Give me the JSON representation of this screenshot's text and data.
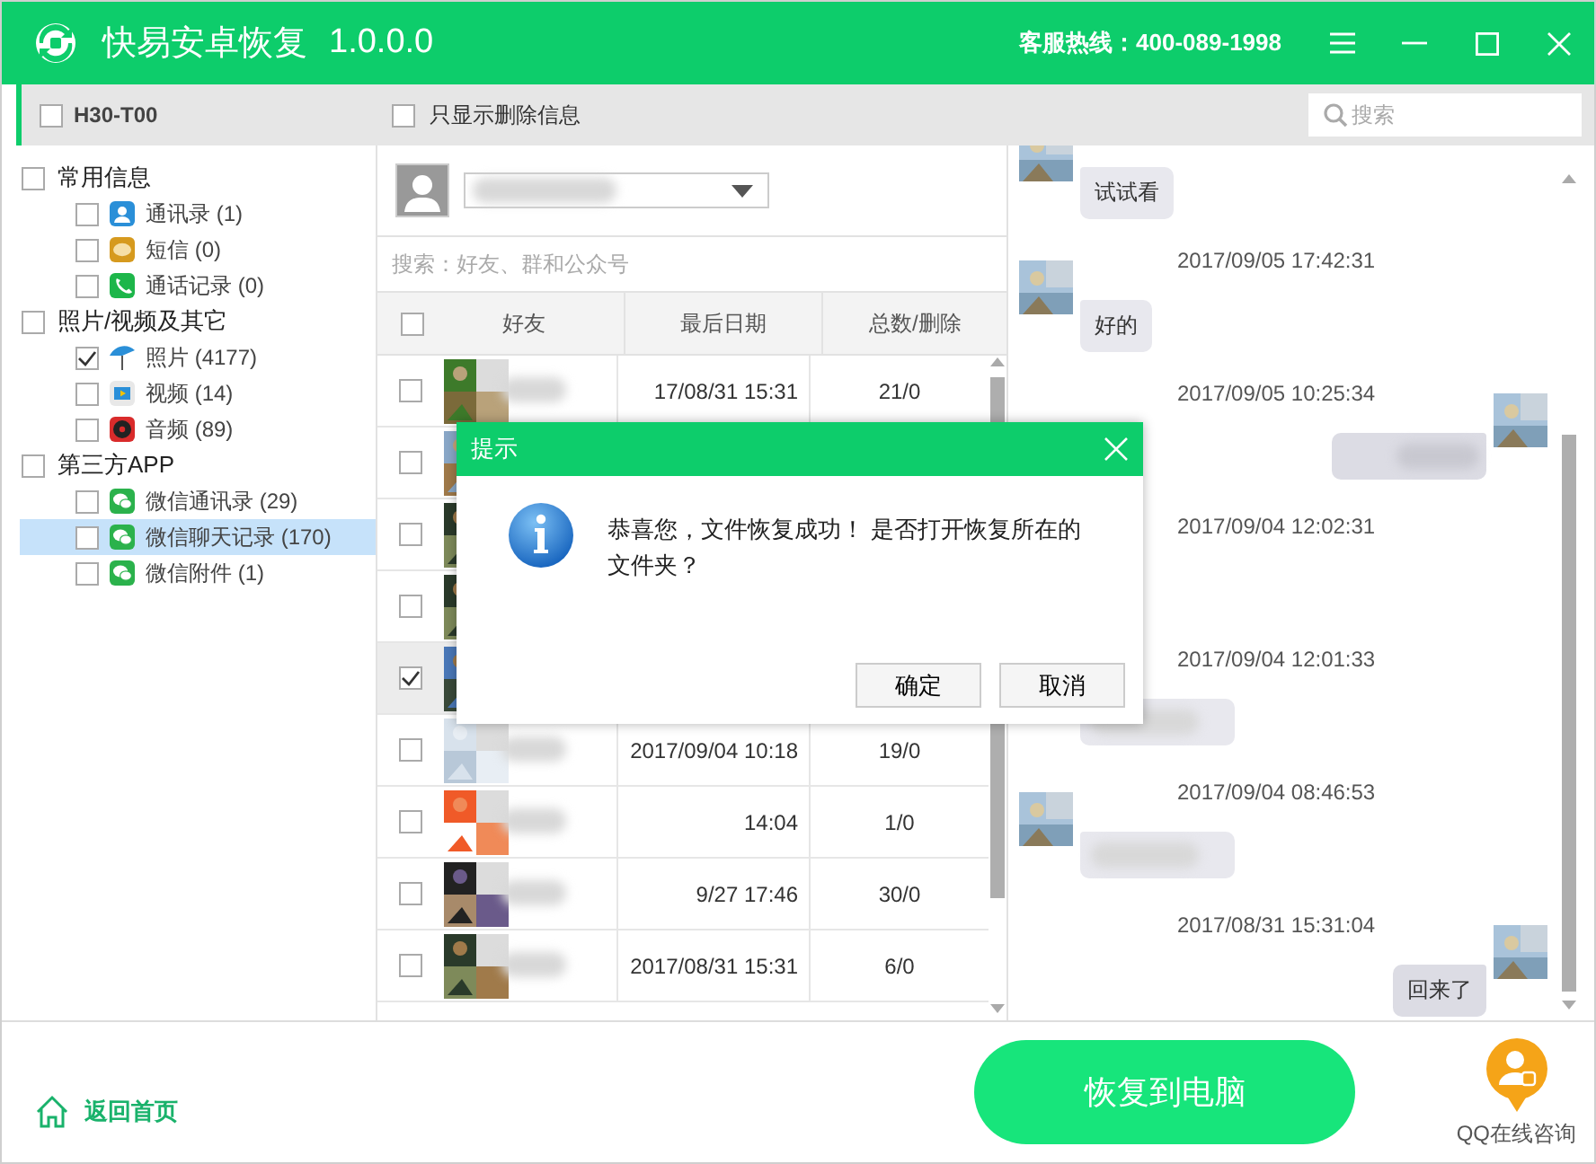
{
  "window": {
    "title": "快易安卓恢复",
    "version": "1.0.0.0",
    "hotline": "客服热线：400-089-1998"
  },
  "toolbar": {
    "device": {
      "label": "H30-T00",
      "checked": false
    },
    "deleted_only": {
      "label": "只显示删除信息",
      "checked": false
    },
    "search": {
      "placeholder": "搜索"
    }
  },
  "sidebar": {
    "groups": [
      {
        "label": "常用信息",
        "checked": false,
        "children": [
          {
            "label": "通讯录 (1)",
            "kind": "contacts",
            "checked": false,
            "selected": false
          },
          {
            "label": "短信 (0)",
            "kind": "sms",
            "checked": false,
            "selected": false
          },
          {
            "label": "通话记录 (0)",
            "kind": "calls",
            "checked": false,
            "selected": false
          }
        ]
      },
      {
        "label": "照片/视频及其它",
        "checked": false,
        "children": [
          {
            "label": "照片 (4177)",
            "kind": "photos",
            "checked": true,
            "selected": false
          },
          {
            "label": "视频 (14)",
            "kind": "video",
            "checked": false,
            "selected": false
          },
          {
            "label": "音频 (89)",
            "kind": "audio",
            "checked": false,
            "selected": false
          }
        ]
      },
      {
        "label": "第三方APP",
        "checked": false,
        "children": [
          {
            "label": "微信通讯录 (29)",
            "kind": "wechat",
            "checked": false,
            "selected": false
          },
          {
            "label": "微信聊天记录 (170)",
            "kind": "wechat",
            "checked": false,
            "selected": true
          },
          {
            "label": "微信附件 (1)",
            "kind": "wechat",
            "checked": false,
            "selected": false
          }
        ]
      }
    ]
  },
  "friends": {
    "search": {
      "placeholder": "搜索：好友、群和公众号"
    },
    "header_checked": false,
    "columns": [
      "好友",
      "最后日期",
      "总数/删除"
    ],
    "rows": [
      {
        "checked": false,
        "selected": false,
        "date": "17/08/31 15:31",
        "count": "21/0"
      },
      {
        "checked": false,
        "selected": false
      },
      {
        "checked": false,
        "selected": false
      },
      {
        "checked": false,
        "selected": false
      },
      {
        "checked": true,
        "selected": true
      },
      {
        "checked": false,
        "selected": false,
        "date": "2017/09/04 10:18",
        "count": "19/0"
      },
      {
        "checked": false,
        "selected": false,
        "date": "14:04",
        "count": "1/0"
      },
      {
        "checked": false,
        "selected": false,
        "date": "9/27 17:46",
        "count": "30/0"
      },
      {
        "checked": false,
        "selected": false,
        "date": "2017/08/31 15:31",
        "count": "6/0"
      }
    ]
  },
  "chat": {
    "messages": [
      {
        "kind": "bubble",
        "outgoing": false,
        "text": "试试看"
      },
      {
        "kind": "time",
        "text": "2017/09/05 17:42:31"
      },
      {
        "kind": "bubble",
        "outgoing": false,
        "text": "好的"
      },
      {
        "kind": "time",
        "text": "2017/09/05 10:25:34"
      },
      {
        "kind": "bubble",
        "outgoing": true
      },
      {
        "kind": "time",
        "text": "2017/09/04 12:02:31"
      },
      {
        "kind": "gap"
      },
      {
        "kind": "time",
        "text": "2017/09/04 12:01:33"
      },
      {
        "kind": "bubble",
        "outgoing": false
      },
      {
        "kind": "time",
        "text": "2017/09/04 08:46:53"
      },
      {
        "kind": "bubble",
        "outgoing": false
      },
      {
        "kind": "time",
        "text": "2017/08/31 15:31:04"
      },
      {
        "kind": "bubble",
        "outgoing": true,
        "text": "回来了"
      }
    ]
  },
  "dialog": {
    "title": "提示",
    "message": "恭喜您，文件恢复成功！ 是否打开恢复所在的文件夹？",
    "buttons": [
      "确定",
      "取消"
    ]
  },
  "footer": {
    "home_link": "返回首页",
    "restore_button": "恢复到电脑",
    "consult_label": "QQ在线咨询"
  }
}
